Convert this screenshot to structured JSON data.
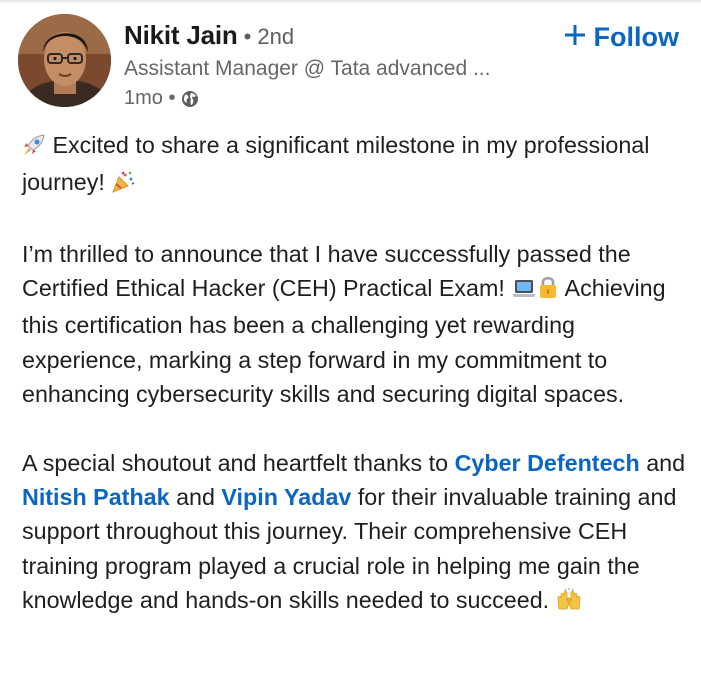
{
  "author": {
    "name": "Nikit Jain",
    "connection_degree": "• 2nd",
    "headline": "Assistant Manager @ Tata advanced ...",
    "post_age": "1mo •",
    "visibility_icon": "globe-icon"
  },
  "follow_label": "Follow",
  "follow_icon": "plus-icon",
  "post": {
    "p1": {
      "emoji_start": "rocket-emoji",
      "text": " Excited to share a significant milestone in my professional journey! ",
      "emoji_end": "party-popper-emoji"
    },
    "p2": {
      "text_a": "I’m thrilled to announce that I have successfully passed the Certified Ethical Hacker (CEH) Practical Exam! ",
      "emoji_a": "laptop-emoji",
      "emoji_b": "lock-emoji",
      "text_b": " Achieving this certification has been a challenging yet rewarding experience, marking a step forward in my commitment to enhancing cybersecurity skills and securing digital spaces."
    },
    "p3": {
      "text_a": "A special shoutout and heartfelt thanks to ",
      "mention_1": "Cyber Defentech",
      "text_b": " and ",
      "mention_2": "Nitish Pathak",
      "text_c": " and ",
      "mention_3": "Vipin Yadav",
      "text_d": " for their invaluable training and support throughout this journey. Their comprehensive CEH training program played a crucial role in helping me gain the knowledge and hands-on skills needed to succeed. ",
      "emoji_end": "raising-hands-emoji"
    }
  },
  "colors": {
    "link_blue": "#0a66c2",
    "text": "#1f1f1f",
    "muted": "#666666"
  }
}
